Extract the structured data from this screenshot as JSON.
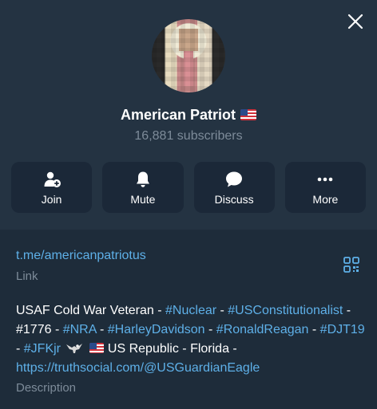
{
  "channel": {
    "title": "American Patriot",
    "title_flag": "us-flag",
    "subscribers": "16,881 subscribers"
  },
  "actions": [
    {
      "label": "Join",
      "icon": "join-icon"
    },
    {
      "label": "Mute",
      "icon": "bell-icon"
    },
    {
      "label": "Discuss",
      "icon": "chat-icon"
    },
    {
      "label": "More",
      "icon": "more-icon"
    }
  ],
  "info": {
    "link": "t.me/americanpatriotus",
    "link_label": "Link",
    "description_label": "Description",
    "description": {
      "t1": "USAF Cold War Veteran - ",
      "h1": "#Nuclear",
      "t2": " - ",
      "h2": "#USConstitutionalist",
      "t3": " - #1776 - ",
      "h3": "#NRA",
      "t4": " - ",
      "h4": "#HarleyDavidson",
      "t5": " - ",
      "h5": "#RonaldReagan",
      "t6": " - ",
      "h6": "#DJT19",
      "t7": " - ",
      "h7": "#JFKjr",
      "t8": " US Republic - Florida - ",
      "url": "https://truthsocial.com/@USGuardianEagle"
    }
  },
  "colors": {
    "header_bg": "#243342",
    "body_bg": "#1e2c3a",
    "button_bg": "#1b2838",
    "accent": "#5eb0e8",
    "muted": "#7d8b99"
  }
}
